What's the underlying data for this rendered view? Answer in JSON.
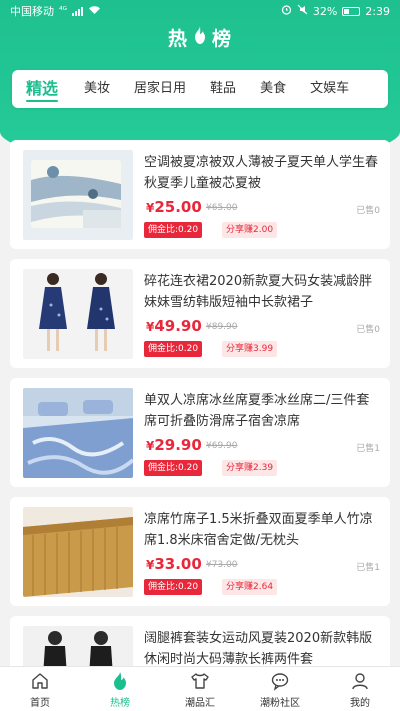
{
  "status_bar": {
    "carrier": "中国移动",
    "network": "⁴ᴳ",
    "battery": "32%",
    "time": "2:39"
  },
  "title": {
    "left": "热",
    "right": "榜"
  },
  "tabs": [
    {
      "label": "精选",
      "active": true
    },
    {
      "label": "美妆"
    },
    {
      "label": "居家日用"
    },
    {
      "label": "鞋品"
    },
    {
      "label": "美食"
    },
    {
      "label": "文娱车"
    }
  ],
  "products": [
    {
      "title": "空调被夏凉被双人薄被子夏天单人学生春秋夏季儿童被芯夏被",
      "currency": "¥",
      "price": "25.00",
      "original_price": "¥65.00",
      "sold": "已售0",
      "commission": "佣金比:0.20",
      "share": "分享赚2.00",
      "image": "bedding-quilt"
    },
    {
      "title": "碎花连衣裙2020新款夏大码女装减龄胖妹妹雪纺韩版短袖中长款裙子",
      "currency": "¥",
      "price": "49.90",
      "original_price": "¥89.90",
      "sold": "已售0",
      "commission": "佣金比:0.20",
      "share": "分享赚3.99",
      "image": "floral-dress"
    },
    {
      "title": "单双人凉席冰丝席夏季冰丝席二/三件套席可折叠防滑席子宿舍凉席",
      "currency": "¥",
      "price": "29.90",
      "original_price": "¥69.90",
      "sold": "已售1",
      "commission": "佣金比:0.20",
      "share": "分享赚2.39",
      "image": "ice-silk-mat"
    },
    {
      "title": "凉席竹席子1.5米折叠双面夏季单人竹凉席1.8米床宿舍定做/无枕头",
      "currency": "¥",
      "price": "33.00",
      "original_price": "¥73.00",
      "sold": "已售1",
      "commission": "佣金比:0.20",
      "share": "分享赚2.64",
      "image": "bamboo-mat"
    },
    {
      "title": "阔腿裤套装女运动风夏装2020新款韩版休闲时尚大码薄款长裤两件套",
      "currency": "¥",
      "price": "",
      "original_price": "",
      "sold": "",
      "commission": "",
      "share": "",
      "image": "outfit-set"
    }
  ],
  "bottom_nav": [
    {
      "label": "首页",
      "icon": "home-icon"
    },
    {
      "label": "热榜",
      "icon": "flame-icon",
      "active": true
    },
    {
      "label": "潮品汇",
      "icon": "shirt-icon"
    },
    {
      "label": "潮粉社区",
      "icon": "community-icon"
    },
    {
      "label": "我的",
      "icon": "profile-icon"
    }
  ],
  "colors": {
    "brand_green": "#1bbf8d",
    "price_red": "#e8283a"
  }
}
